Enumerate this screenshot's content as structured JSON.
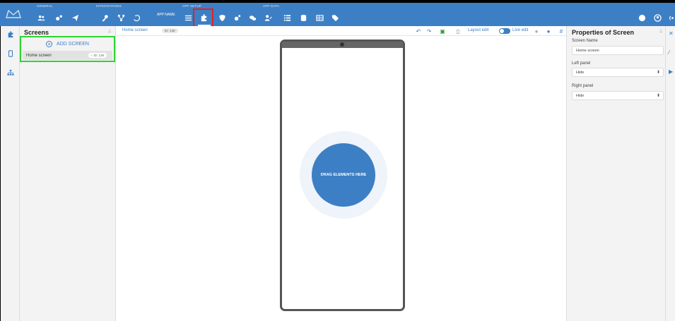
{
  "topbar": {
    "groups": {
      "general": "GENERAL",
      "integrations": "INTEGRATIONS",
      "app_setup": "APP SETUP",
      "app_data": "APP DATA"
    },
    "app_name": "APP NAME",
    "icons": [
      "users-icon",
      "settings-icon",
      "send-icon",
      "key-icon",
      "flow-icon",
      "history-icon",
      "menu-icon",
      "puzzle-icon",
      "shield-icon",
      "gear-sync-icon",
      "chat-icon",
      "user-edit-icon",
      "list-icon",
      "database-icon",
      "table-icon",
      "tag-icon",
      "help-icon",
      "account-icon",
      "broadcast-icon"
    ],
    "accent": "#3d7fc4",
    "active_highlight": "#e0221e"
  },
  "screens_panel": {
    "title": "Screens",
    "add_label": "ADD SCREEN",
    "items": [
      {
        "name": "Home screen",
        "id": "ID: 138"
      }
    ],
    "highlight": "#2ed62e"
  },
  "canvas": {
    "breadcrumb": "Home screen",
    "breadcrumb_id": "ID: 138",
    "layout_edit": "Layout edit",
    "live_edit": "Live edit",
    "drop_label": "DRAG ELEMENTS HERE"
  },
  "properties": {
    "title": "Properties of Screen",
    "screen_name_label": "Screen Name",
    "screen_name_value": "Home screen",
    "left_panel_label": "Left panel",
    "left_panel_value": "Hide",
    "right_panel_label": "Right panel",
    "right_panel_value": "Hide"
  }
}
